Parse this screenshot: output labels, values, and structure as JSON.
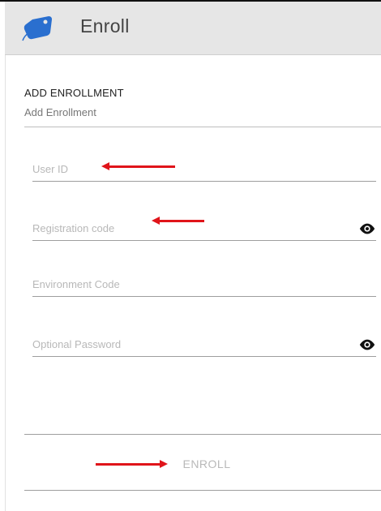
{
  "appbar": {
    "title": "Enroll",
    "logo_icon": "tag-icon",
    "background": "#e6e6e6"
  },
  "section": {
    "title": "ADD ENROLLMENT",
    "subtitle": "Add Enrollment"
  },
  "fields": [
    {
      "placeholder": "User ID",
      "value": "",
      "type": "text",
      "has_toggle": false
    },
    {
      "placeholder": "Registration code",
      "value": "",
      "type": "password",
      "has_toggle": true,
      "toggle_icon": "eye-icon"
    },
    {
      "placeholder": "Environment Code",
      "value": "",
      "type": "text",
      "has_toggle": false
    },
    {
      "placeholder": "Optional Password",
      "value": "",
      "type": "password",
      "has_toggle": true,
      "toggle_icon": "eye-icon"
    }
  ],
  "actions": {
    "enroll_label": "ENROLL"
  },
  "annotations": {
    "arrow_color": "#e0141a"
  },
  "colors": {
    "logo_blue": "#2a6fcf",
    "label_gray": "#b8b8b8",
    "disabled_button_text": "#b9b9b9"
  }
}
